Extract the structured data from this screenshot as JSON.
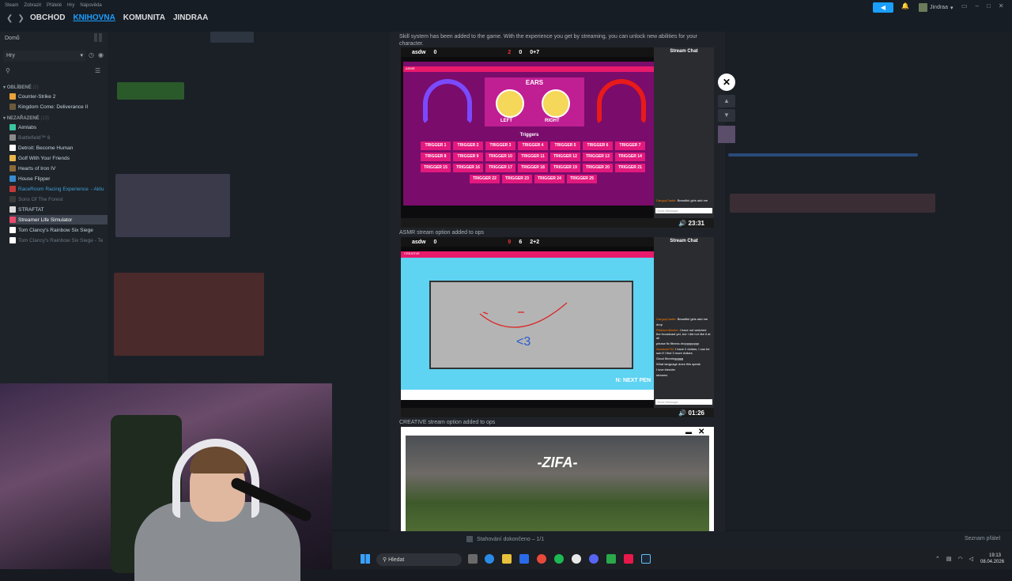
{
  "window": {
    "menu": [
      "Steam",
      "Zobrazit",
      "Přátelé",
      "Hry",
      "Nápověda"
    ],
    "nav": [
      "OBCHOD",
      "KNIHOVNA",
      "KOMUNITA",
      "JINDRAA"
    ],
    "active_nav": "KNIHOVNA",
    "user": "Jindraa"
  },
  "sidebar": {
    "home": "Domů",
    "filter": "Hry",
    "cat_fav": "OBLÍBENÉ",
    "cat_fav_count": "(2)",
    "cat_unsorted": "NEZAŘAZENÉ",
    "cat_unsorted_count": "(13)",
    "fav": [
      {
        "label": "Counter-Strike 2",
        "color": "#e8a33a"
      },
      {
        "label": "Kingdom Come: Deliverance II",
        "color": "#6b5a3a"
      }
    ],
    "games": [
      {
        "label": "Aimlabs",
        "color": "#3ac4a0"
      },
      {
        "label": "Battlefield™ 6",
        "color": "#8a8a8a",
        "dim": true
      },
      {
        "label": "Detroit: Become Human",
        "color": "#fff"
      },
      {
        "label": "Golf With Your Friends",
        "color": "#e9b64a"
      },
      {
        "label": "Hearts of Iron IV",
        "color": "#8a6a3a"
      },
      {
        "label": "House Flipper",
        "color": "#3a8acf"
      },
      {
        "label": "RaceRoom Racing Experience",
        "suffix": " - Aktu",
        "color": "#c03a3a",
        "update": true
      },
      {
        "label": "Sons Of The Forest",
        "color": "#3a3a3a",
        "dim": true
      },
      {
        "label": "STRAFTAT",
        "color": "#ddd"
      },
      {
        "label": "Streamer Life Simulator",
        "color": "#e84a6a",
        "selected": true
      },
      {
        "label": "Tom Clancy's Rainbow Six Siege",
        "color": "#fff"
      },
      {
        "label": "Tom Clancy's Rainbow Six Siege - Te",
        "color": "#fff",
        "dim": true
      }
    ]
  },
  "modal": {
    "caption1": "Skill system has been added to the game. With the experience you get by streaming, you can unlock new abilities for your character.",
    "caption2": "ASMR stream option added to ops",
    "caption3": "CREATIVE stream option added to ops",
    "shot1": {
      "channel": "asdw",
      "viewers": "0",
      "likes": "2",
      "dislikes": "0",
      "xp": "0+7",
      "chat_title": "Stream Chat",
      "banner": "ASMR",
      "title": "EARS",
      "left": "LEFT",
      "right": "RIGHT",
      "triggers_title": "Triggers",
      "timer": "23:31",
      "chat_msg_user": "GargoyCastle:",
      "chat_msg": "Beautiful girls add me",
      "send": "Send Message",
      "triggers": [
        "TRIGGER 1",
        "TRIGGER 2",
        "TRIGGER 3",
        "TRIGGER 4",
        "TRIGGER 5",
        "TRIGGER 6",
        "TRIGGER 7",
        "TRIGGER 8",
        "TRIGGER 9",
        "TRIGGER 10",
        "TRIGGER 11",
        "TRIGGER 12",
        "TRIGGER 13",
        "TRIGGER 14",
        "TRIGGER 15",
        "TRIGGER 16",
        "TRIGGER 17",
        "TRIGGER 18",
        "TRIGGER 19",
        "TRIGGER 20",
        "TRIGGER 21",
        "TRIGGER 22",
        "TRIGGER 23",
        "TRIGGER 24",
        "TRIGGER 25"
      ]
    },
    "shot2": {
      "channel": "asdw",
      "viewers": "0",
      "likes": "9",
      "dislikes": "6",
      "xp": "2+2",
      "chat_title": "Stream Chat",
      "banner": "CREATIVE",
      "next_pen": "N: NEXT PEN",
      "timer": "01:26",
      "send": "Send Message",
      "chat": [
        {
          "u": "GargoyCastle:",
          "m": "Beautiful girls add me"
        },
        {
          "u": "",
          "m": "drop"
        },
        {
          "u": "PlatinumMonke:",
          "m": "I have not watched the broadcast yet, but I did not like it at all"
        },
        {
          "u": "",
          "m": "please fix fitness dropppppppp"
        },
        {
          "u": "AssassinTM:",
          "m": "I have 2 dollars, I can be sub if I find 3 more dollars"
        },
        {
          "u": "",
          "m": "Good Morninggggg"
        },
        {
          "u": "",
          "m": "What language does this speak"
        },
        {
          "u": "",
          "m": "I love blender"
        },
        {
          "u": "",
          "m": "streams"
        }
      ]
    },
    "shot3": {
      "title": "-ZIFA-"
    }
  },
  "downloads": {
    "status": "Stahování dokončeno – 1/1",
    "friends": "Seznam přátel"
  },
  "taskbar": {
    "search": "Hledat",
    "time": "19:13",
    "date": "08.04.2026"
  }
}
